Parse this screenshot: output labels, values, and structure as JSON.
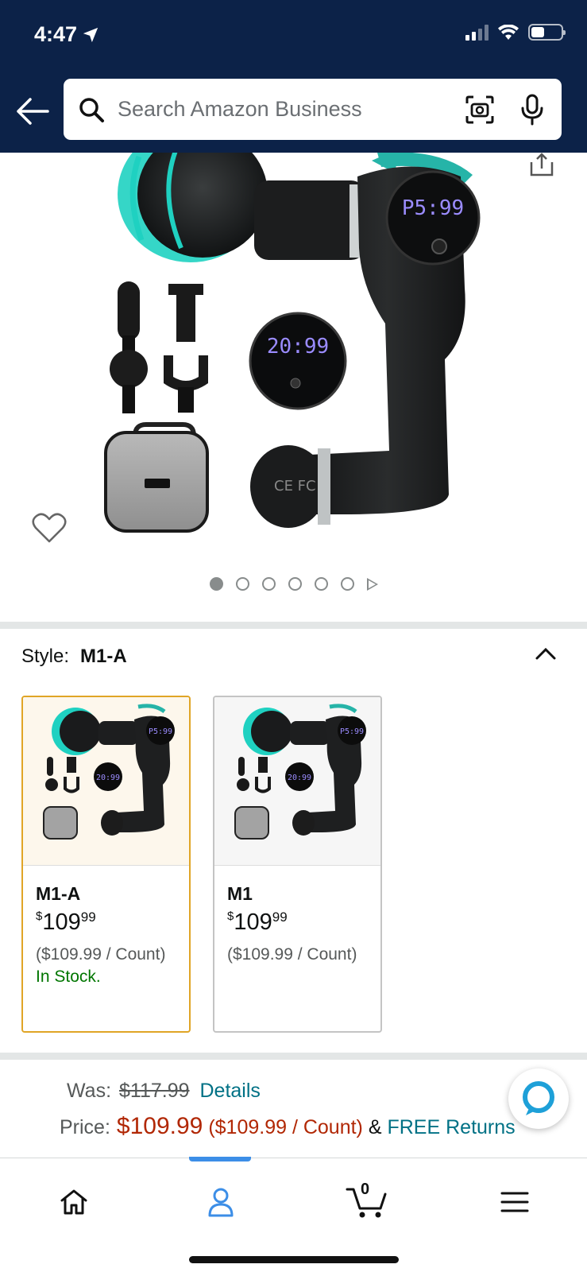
{
  "status_bar": {
    "time": "4:47"
  },
  "search": {
    "placeholder": "Search Amazon Business"
  },
  "product": {
    "display_left": "20:99",
    "display_main": "P5:99",
    "case_label": "",
    "carousel": {
      "count": 6,
      "active": 0
    }
  },
  "style": {
    "label": "Style:",
    "selected": "M1-A",
    "options": [
      {
        "name": "M1-A",
        "price_dollars": "109",
        "price_cents": "99",
        "currency": "$",
        "unit": "($109.99 / Count)",
        "stock": "In Stock."
      },
      {
        "name": "M1",
        "price_dollars": "109",
        "price_cents": "99",
        "currency": "$",
        "unit": "($109.99 / Count)",
        "stock": ""
      }
    ]
  },
  "pricing": {
    "was_label": "Was:",
    "was_value": "$117.99",
    "details_link": "Details",
    "price_label": "Price:",
    "price_value": "$109.99",
    "price_per": "($109.99 / Count)",
    "amp": "&",
    "returns_link": "FREE Returns"
  },
  "bottom_nav": {
    "cart_count": "0"
  },
  "colors": {
    "header": "#0c2248",
    "accent_teal": "#1fd1c1",
    "price_red": "#b12704",
    "link": "#007185",
    "stock_green": "#007600",
    "selected_border": "#e0a526"
  }
}
